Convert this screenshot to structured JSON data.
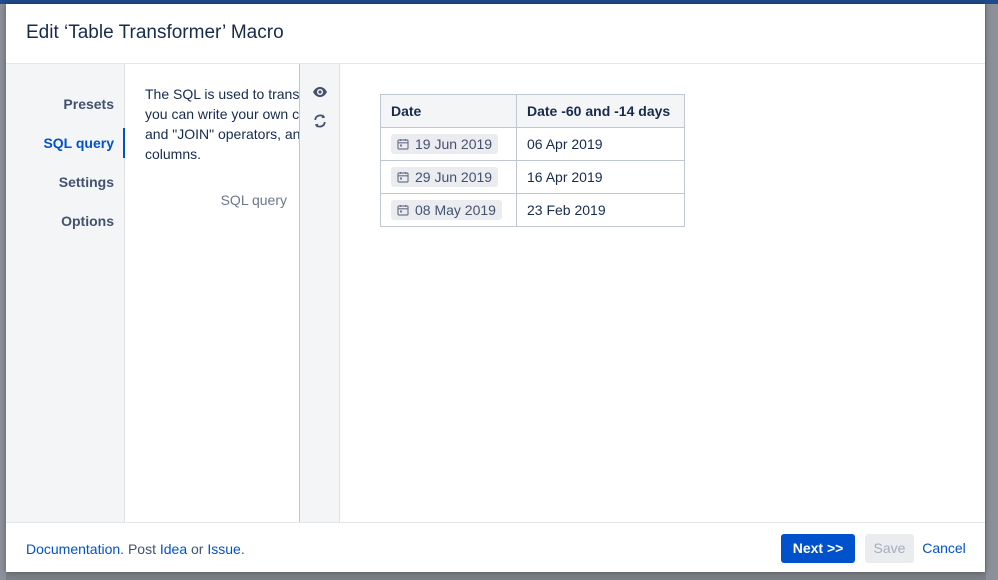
{
  "dialog": {
    "title": "Edit ‘Table Transformer’ Macro"
  },
  "side_nav": {
    "items": [
      {
        "label": "Presets",
        "active": false
      },
      {
        "label": "SQL query",
        "active": true
      },
      {
        "label": "Settings",
        "active": false
      },
      {
        "label": "Options",
        "active": false
      }
    ]
  },
  "description": {
    "text": "The SQL is used to transform the table. Here\nyou can write your own custom queries, use \"UNION\" and \"JOIN\" operators, and calculate\ncolumns.",
    "field_label": "SQL query"
  },
  "tools": {
    "preview_icon": "eye-icon",
    "refresh_icon": "refresh-icon"
  },
  "table": {
    "headers": [
      "Date",
      "Date -60 and -14 days"
    ],
    "rows": [
      {
        "date": "19 Jun 2019",
        "computed": "06 Apr 2019"
      },
      {
        "date": "29 Jun 2019",
        "computed": "16 Apr 2019"
      },
      {
        "date": "08 May 2019",
        "computed": "23 Feb 2019"
      }
    ]
  },
  "footer": {
    "documentation": "Documentation",
    "sep1": ". Post ",
    "idea": "Idea",
    "sep2": " or ",
    "issue": "Issue",
    "sep3": ".",
    "next_label": "Next >>",
    "save_label": "Save",
    "cancel_label": "Cancel"
  },
  "colors": {
    "primary": "#0052cc",
    "text": "#172b4d",
    "muted": "#6b778c",
    "panel_bg": "#f4f5f7"
  }
}
